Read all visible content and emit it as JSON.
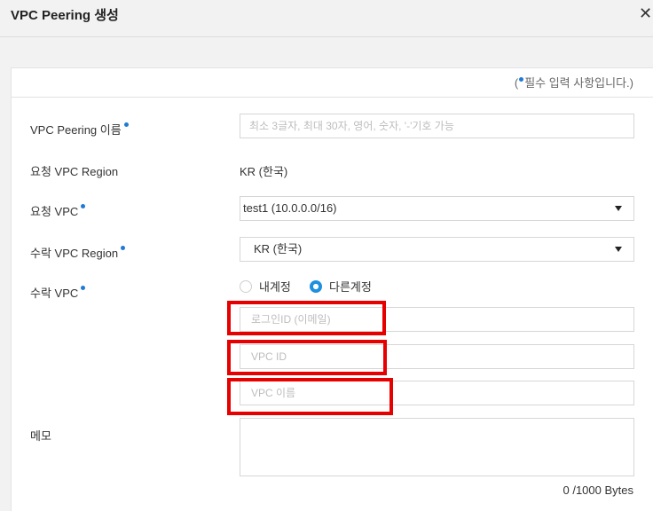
{
  "dialog": {
    "title": "VPC Peering 생성",
    "close_icon": "close-icon"
  },
  "required_note": {
    "prefix": "(",
    "text": "필수 입력 사항입니다.)",
    "dot_color": "#1f7ad6"
  },
  "form": {
    "peering_name": {
      "label": "VPC Peering 이름",
      "required": true,
      "value": "",
      "placeholder": "최소 3글자, 최대 30자, 영어, 숫자, '-'기호 가능"
    },
    "request_region": {
      "label": "요청 VPC Region",
      "value": "KR (한국)"
    },
    "request_vpc": {
      "label": "요청 VPC",
      "required": true,
      "selected": "test1 (10.0.0.0/16)"
    },
    "accept_region": {
      "label": "수락 VPC Region",
      "required": true,
      "selected": "KR (한국)"
    },
    "accept_vpc": {
      "label": "수락 VPC",
      "required": true,
      "options": [
        {
          "label": "내계정",
          "checked": false
        },
        {
          "label": "다른계정",
          "checked": true
        }
      ],
      "login_id": {
        "value": "",
        "placeholder": "로그인ID (이메일)"
      },
      "vpc_id": {
        "value": "",
        "placeholder": "VPC ID"
      },
      "vpc_name": {
        "value": "",
        "placeholder": "VPC 이름"
      }
    },
    "memo": {
      "label": "메모",
      "value": "",
      "byte_count": "0 /1000 Bytes"
    }
  },
  "colors": {
    "accent": "#1f8fe0",
    "highlight": "#e60000"
  }
}
